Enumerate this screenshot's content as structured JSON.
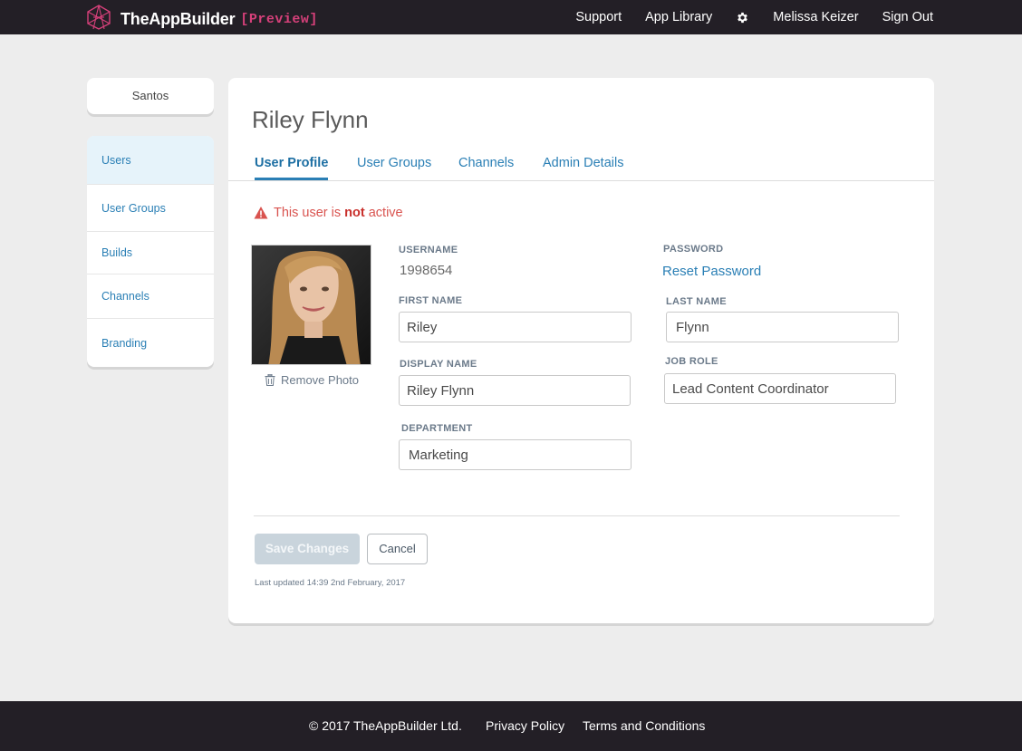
{
  "header": {
    "brand": "TheAppBuilder",
    "preview": "[Preview]",
    "nav": {
      "support": "Support",
      "app_library": "App Library",
      "settings_icon": "gear-icon",
      "user": "Melissa Keizer",
      "sign_out": "Sign Out"
    }
  },
  "sidebar": {
    "org": "Santos",
    "items": [
      {
        "label": "Users",
        "active": true
      },
      {
        "label": "User Groups",
        "active": false
      },
      {
        "label": "Builds",
        "active": false
      },
      {
        "label": "Channels",
        "active": false
      },
      {
        "label": "Branding",
        "active": false
      }
    ]
  },
  "main": {
    "title": "Riley Flynn",
    "tabs": [
      {
        "label": "User Profile",
        "active": true
      },
      {
        "label": "User Groups",
        "active": false
      },
      {
        "label": "Channels",
        "active": false
      },
      {
        "label": "Admin Details",
        "active": false
      }
    ],
    "warning": {
      "prefix": "This user is ",
      "emphasis": "not",
      "suffix": " active",
      "icon": "warning-triangle-icon"
    },
    "photo": {
      "remove_label": "Remove Photo",
      "remove_icon": "trash-icon"
    },
    "fields": {
      "username_label": "USERNAME",
      "username_value": "1998654",
      "password_label": "PASSWORD",
      "reset_password": "Reset Password",
      "first_name_label": "FIRST NAME",
      "first_name_value": "Riley",
      "last_name_label": "LAST NAME",
      "last_name_value": "Flynn",
      "display_name_label": "DISPLAY NAME",
      "display_name_value": "Riley Flynn",
      "job_role_label": "JOB ROLE",
      "job_role_value": "Lead Content Coordinator",
      "department_label": "DEPARTMENT",
      "department_value": "Marketing"
    },
    "buttons": {
      "save": "Save Changes",
      "cancel": "Cancel"
    },
    "last_updated": "Last updated 14:39 2nd February, 2017"
  },
  "footer": {
    "copyright": "© 2017 TheAppBuilder Ltd.",
    "privacy": "Privacy Policy",
    "terms": "Terms and Conditions"
  },
  "colors": {
    "topbar": "#231f26",
    "accent": "#2a7fb5",
    "brand_pink": "#d6407a",
    "warning": "#d9534f",
    "save_disabled": "#c9d4dc"
  }
}
